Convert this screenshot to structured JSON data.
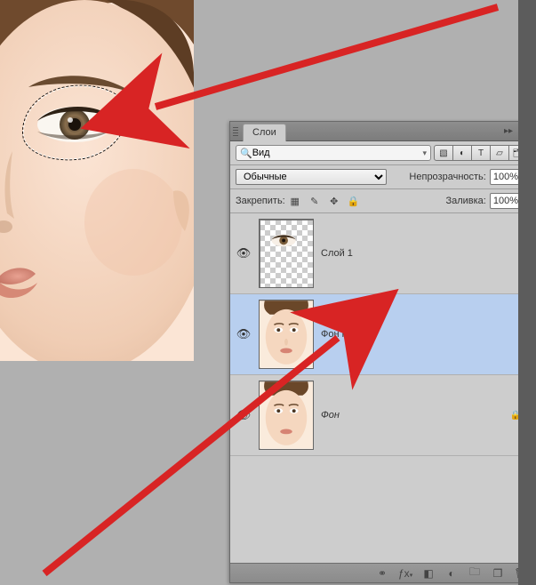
{
  "panel": {
    "title": "Слои",
    "search_label": "Вид",
    "blend_mode": "Обычные",
    "opacity_label": "Непрозрачность:",
    "opacity_value": "100%",
    "fill_label": "Заливка:",
    "fill_value": "100%",
    "lock_label": "Закрепить:"
  },
  "layers": [
    {
      "name": "Слой 1",
      "visible": true,
      "selected": false,
      "thumb": "eye",
      "locked": false,
      "italic": false
    },
    {
      "name": "Фон копия",
      "visible": true,
      "selected": true,
      "thumb": "face",
      "locked": false,
      "italic": false
    },
    {
      "name": "Фон",
      "visible": true,
      "selected": false,
      "thumb": "face",
      "locked": true,
      "italic": true
    }
  ],
  "filter_icons": [
    "image",
    "adjust",
    "text",
    "shape",
    "smart"
  ],
  "lock_icons": [
    "checker",
    "brush",
    "move",
    "lock"
  ],
  "footer_icons": [
    "link",
    "fx",
    "mask",
    "adjust",
    "folder",
    "new",
    "trash"
  ]
}
